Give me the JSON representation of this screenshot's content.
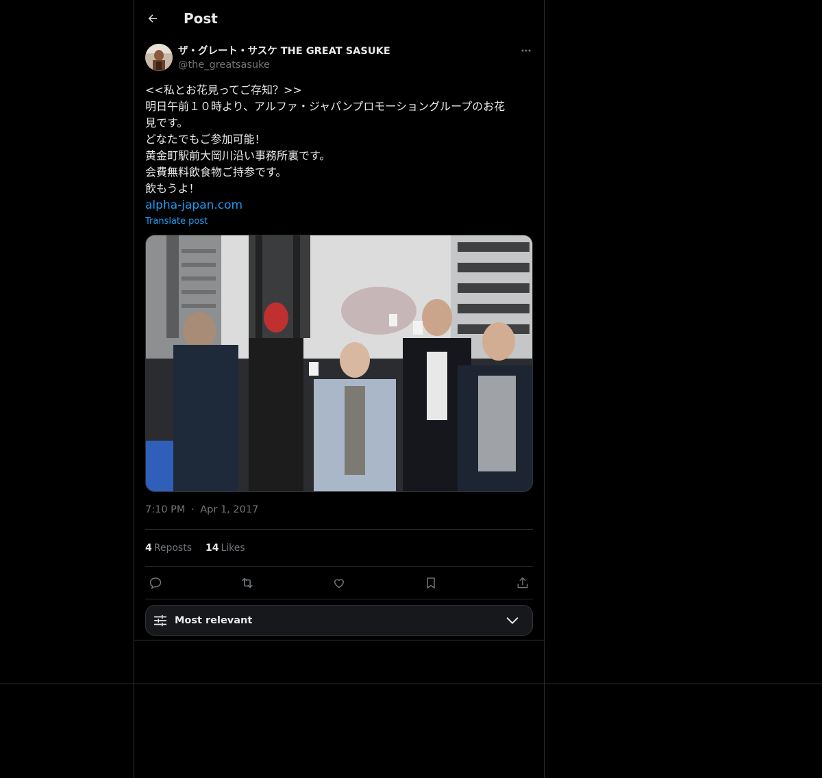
{
  "header": {
    "title": "Post"
  },
  "author": {
    "display_name": "ザ・グレート・サスケ THE GREAT SASUKE",
    "handle": "@the_greatsasuke"
  },
  "post": {
    "lines": [
      "<<私とお花見ってご存知？>>",
      "明日午前１０時より、アルファ・ジャパンプロモーショングループのお花",
      "見です。",
      "どなたでもご参加可能！",
      "黄金町駅前大岡川沿い事務所裏です。",
      "会費無料飲食物ご持参です。",
      "飲もうよ！"
    ],
    "link": "alpha-japan.com",
    "translate_label": "Translate post"
  },
  "meta": {
    "time": "7:10 PM",
    "separator": "·",
    "date": "Apr 1, 2017"
  },
  "stats": {
    "reposts_count": "4",
    "reposts_label": "Reposts",
    "likes_count": "14",
    "likes_label": "Likes"
  },
  "replies": {
    "sort_label": "Most relevant"
  },
  "colors": {
    "background": "#000000",
    "text": "#e7e9ea",
    "secondary": "#71767b",
    "accent": "#1d9bf0",
    "border": "#2f3336"
  }
}
